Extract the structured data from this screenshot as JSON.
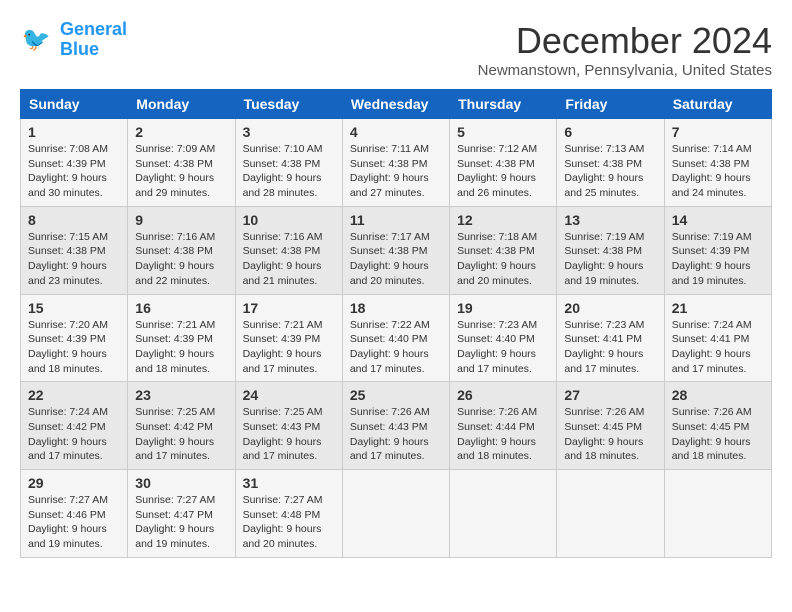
{
  "logo": {
    "line1": "General",
    "line2": "Blue"
  },
  "title": "December 2024",
  "subtitle": "Newmanstown, Pennsylvania, United States",
  "days_of_week": [
    "Sunday",
    "Monday",
    "Tuesday",
    "Wednesday",
    "Thursday",
    "Friday",
    "Saturday"
  ],
  "weeks": [
    [
      {
        "day": "1",
        "sunrise": "7:08 AM",
        "sunset": "4:39 PM",
        "daylight": "9 hours and 30 minutes."
      },
      {
        "day": "2",
        "sunrise": "7:09 AM",
        "sunset": "4:38 PM",
        "daylight": "9 hours and 29 minutes."
      },
      {
        "day": "3",
        "sunrise": "7:10 AM",
        "sunset": "4:38 PM",
        "daylight": "9 hours and 28 minutes."
      },
      {
        "day": "4",
        "sunrise": "7:11 AM",
        "sunset": "4:38 PM",
        "daylight": "9 hours and 27 minutes."
      },
      {
        "day": "5",
        "sunrise": "7:12 AM",
        "sunset": "4:38 PM",
        "daylight": "9 hours and 26 minutes."
      },
      {
        "day": "6",
        "sunrise": "7:13 AM",
        "sunset": "4:38 PM",
        "daylight": "9 hours and 25 minutes."
      },
      {
        "day": "7",
        "sunrise": "7:14 AM",
        "sunset": "4:38 PM",
        "daylight": "9 hours and 24 minutes."
      }
    ],
    [
      {
        "day": "8",
        "sunrise": "7:15 AM",
        "sunset": "4:38 PM",
        "daylight": "9 hours and 23 minutes."
      },
      {
        "day": "9",
        "sunrise": "7:16 AM",
        "sunset": "4:38 PM",
        "daylight": "9 hours and 22 minutes."
      },
      {
        "day": "10",
        "sunrise": "7:16 AM",
        "sunset": "4:38 PM",
        "daylight": "9 hours and 21 minutes."
      },
      {
        "day": "11",
        "sunrise": "7:17 AM",
        "sunset": "4:38 PM",
        "daylight": "9 hours and 20 minutes."
      },
      {
        "day": "12",
        "sunrise": "7:18 AM",
        "sunset": "4:38 PM",
        "daylight": "9 hours and 20 minutes."
      },
      {
        "day": "13",
        "sunrise": "7:19 AM",
        "sunset": "4:38 PM",
        "daylight": "9 hours and 19 minutes."
      },
      {
        "day": "14",
        "sunrise": "7:19 AM",
        "sunset": "4:39 PM",
        "daylight": "9 hours and 19 minutes."
      }
    ],
    [
      {
        "day": "15",
        "sunrise": "7:20 AM",
        "sunset": "4:39 PM",
        "daylight": "9 hours and 18 minutes."
      },
      {
        "day": "16",
        "sunrise": "7:21 AM",
        "sunset": "4:39 PM",
        "daylight": "9 hours and 18 minutes."
      },
      {
        "day": "17",
        "sunrise": "7:21 AM",
        "sunset": "4:39 PM",
        "daylight": "9 hours and 17 minutes."
      },
      {
        "day": "18",
        "sunrise": "7:22 AM",
        "sunset": "4:40 PM",
        "daylight": "9 hours and 17 minutes."
      },
      {
        "day": "19",
        "sunrise": "7:23 AM",
        "sunset": "4:40 PM",
        "daylight": "9 hours and 17 minutes."
      },
      {
        "day": "20",
        "sunrise": "7:23 AM",
        "sunset": "4:41 PM",
        "daylight": "9 hours and 17 minutes."
      },
      {
        "day": "21",
        "sunrise": "7:24 AM",
        "sunset": "4:41 PM",
        "daylight": "9 hours and 17 minutes."
      }
    ],
    [
      {
        "day": "22",
        "sunrise": "7:24 AM",
        "sunset": "4:42 PM",
        "daylight": "9 hours and 17 minutes."
      },
      {
        "day": "23",
        "sunrise": "7:25 AM",
        "sunset": "4:42 PM",
        "daylight": "9 hours and 17 minutes."
      },
      {
        "day": "24",
        "sunrise": "7:25 AM",
        "sunset": "4:43 PM",
        "daylight": "9 hours and 17 minutes."
      },
      {
        "day": "25",
        "sunrise": "7:26 AM",
        "sunset": "4:43 PM",
        "daylight": "9 hours and 17 minutes."
      },
      {
        "day": "26",
        "sunrise": "7:26 AM",
        "sunset": "4:44 PM",
        "daylight": "9 hours and 18 minutes."
      },
      {
        "day": "27",
        "sunrise": "7:26 AM",
        "sunset": "4:45 PM",
        "daylight": "9 hours and 18 minutes."
      },
      {
        "day": "28",
        "sunrise": "7:26 AM",
        "sunset": "4:45 PM",
        "daylight": "9 hours and 18 minutes."
      }
    ],
    [
      {
        "day": "29",
        "sunrise": "7:27 AM",
        "sunset": "4:46 PM",
        "daylight": "9 hours and 19 minutes."
      },
      {
        "day": "30",
        "sunrise": "7:27 AM",
        "sunset": "4:47 PM",
        "daylight": "9 hours and 19 minutes."
      },
      {
        "day": "31",
        "sunrise": "7:27 AM",
        "sunset": "4:48 PM",
        "daylight": "9 hours and 20 minutes."
      },
      {
        "day": "",
        "sunrise": "",
        "sunset": "",
        "daylight": ""
      },
      {
        "day": "",
        "sunrise": "",
        "sunset": "",
        "daylight": ""
      },
      {
        "day": "",
        "sunrise": "",
        "sunset": "",
        "daylight": ""
      },
      {
        "day": "",
        "sunrise": "",
        "sunset": "",
        "daylight": ""
      }
    ]
  ],
  "labels": {
    "sunrise": "Sunrise:",
    "sunset": "Sunset:",
    "daylight": "Daylight:"
  }
}
